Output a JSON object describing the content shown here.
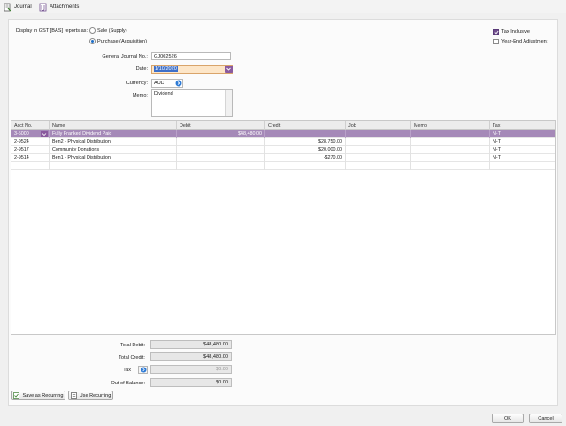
{
  "toolbar": {
    "journal_label": "Journal",
    "attachments_label": "Attachments"
  },
  "gst": {
    "label": "Display in GST [BAS] reports as:",
    "option_sale": "Sale (Supply)",
    "option_purchase": "Purchase (Acquisition)",
    "selected": "purchase"
  },
  "checks": {
    "tax_inclusive_label": "Tax Inclusive",
    "tax_inclusive": true,
    "year_end_label": "Year-End Adjustment",
    "year_end": false
  },
  "form": {
    "journal_no_label": "General Journal No.:",
    "journal_no": "GJ002526",
    "date_label": "Date:",
    "date": "1/10/2020",
    "currency_label": "Currency:",
    "currency": "AUD",
    "memo_label": "Memo:",
    "memo": "Dividend"
  },
  "table": {
    "columns": [
      "Acct No.",
      "Name",
      "Debit",
      "Credit",
      "Job",
      "Memo",
      "Tax"
    ],
    "rows": [
      {
        "acct": "3-5000",
        "name": "Fully Franked Dividend Paid",
        "debit": "$48,480.00",
        "credit": "",
        "job": "",
        "memo": "",
        "tax": "N-T"
      },
      {
        "acct": "2-9524",
        "name": "Ben2 - Physical Distribution",
        "debit": "",
        "credit": "$28,750.00",
        "job": "",
        "memo": "",
        "tax": "N-T"
      },
      {
        "acct": "2-9517",
        "name": "Community Donations",
        "debit": "",
        "credit": "$20,000.00",
        "job": "",
        "memo": "",
        "tax": "N-T"
      },
      {
        "acct": "2-9514",
        "name": "Ben1 - Physical Distribution",
        "debit": "",
        "credit": "-$270.00",
        "job": "",
        "memo": "",
        "tax": "N-T"
      }
    ]
  },
  "totals": {
    "debit_label": "Total Debit:",
    "debit": "$48,480.00",
    "credit_label": "Total Credit:",
    "credit": "$48,480.00",
    "tax_label": "Tax",
    "tax": "$0.00",
    "oob_label": "Out of Balance:",
    "oob": "$0.00"
  },
  "buttons": {
    "save_recurring": "Save as Recurring",
    "use_recurring": "Use Recurring",
    "ok": "OK",
    "cancel": "Cancel"
  },
  "colors": {
    "selection": "#a589b8",
    "accent": "#1f6fc7",
    "date_highlight": "#fde6c8"
  }
}
